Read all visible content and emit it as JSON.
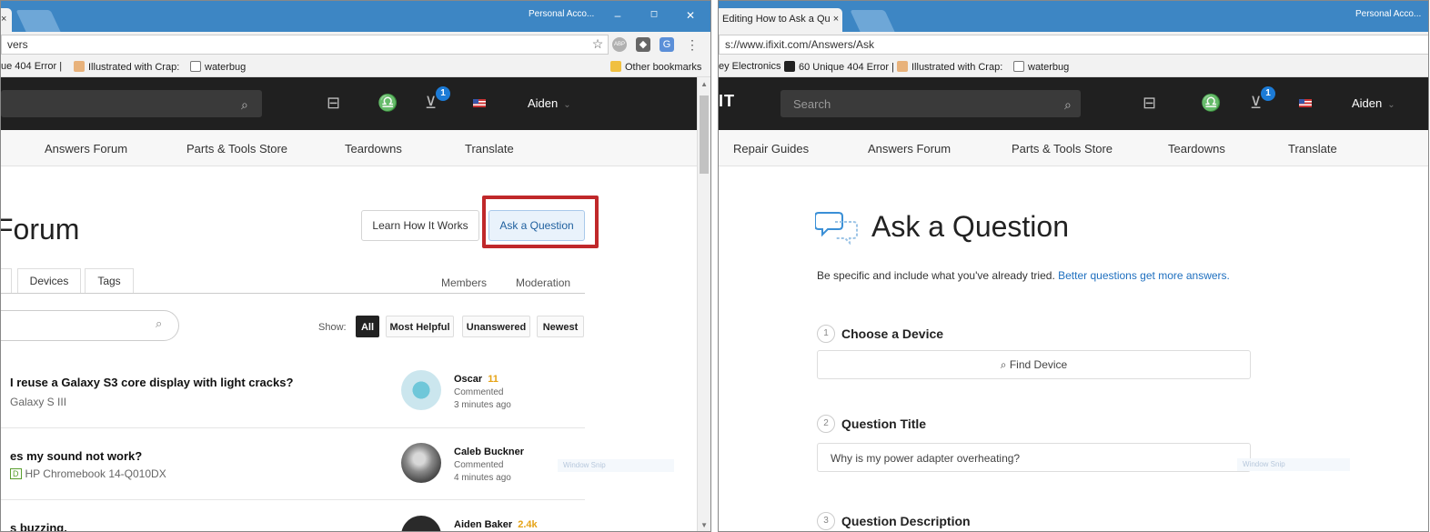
{
  "left": {
    "tab_close": "×",
    "profile": "Personal Acco...",
    "win_minimize": "–",
    "win_maximize": "◻",
    "win_close": "✕",
    "url": "vers",
    "bookmarks": [
      "ue 404 Error |",
      "Illustrated with Crap:",
      "waterbug"
    ],
    "other_bookmarks": "Other bookmarks",
    "cart_count": "1",
    "user": "Aiden",
    "nav": [
      "Answers Forum",
      "Parts & Tools Store",
      "Teardowns",
      "Translate"
    ],
    "title": "Forum",
    "learn_button": "Learn How It Works",
    "ask_button": "Ask a Question",
    "tabs": [
      "Devices",
      "Tags"
    ],
    "right_tabs": [
      "Members",
      "Moderation"
    ],
    "show_label": "Show:",
    "filters": [
      "All",
      "Most Helpful",
      "Unanswered",
      "Newest"
    ],
    "questions": [
      {
        "title": "I reuse a Galaxy S3 core display with light cracks?",
        "device_badge": "",
        "device": "Galaxy S III",
        "author": "Oscar",
        "rep": "11",
        "action": "Commented",
        "time": "3 minutes ago"
      },
      {
        "title": "es my sound not work?",
        "device_badge": "D",
        "device": "HP Chromebook 14-Q010DX",
        "author": "Caleb Buckner",
        "rep": "",
        "action": "Commented",
        "time": "4 minutes ago"
      },
      {
        "title": "s buzzing.",
        "device_badge": "",
        "device": "",
        "author": "Aiden Baker",
        "rep": "2.4k",
        "action": "",
        "time": ""
      }
    ],
    "snip_label": "Window Snip"
  },
  "right": {
    "tab_title": "Editing How to Ask a Qu",
    "tab_close": "×",
    "profile": "Personal Acco...",
    "url": "s://www.ifixit.com/Answers/Ask",
    "bookmarks": [
      "ey Electronics",
      "60 Unique 404 Error |",
      "Illustrated with Crap:",
      "waterbug"
    ],
    "logo": "IT",
    "search_placeholder": "Search",
    "cart_count": "1",
    "user": "Aiden",
    "nav": [
      "Repair Guides",
      "Answers Forum",
      "Parts & Tools Store",
      "Teardowns",
      "Translate"
    ],
    "title": "Ask a Question",
    "lead": "Be specific and include what you've already tried.",
    "lead_link": "Better questions get more answers.",
    "steps": [
      {
        "num": "1",
        "label": "Choose a Device"
      },
      {
        "num": "2",
        "label": "Question Title"
      },
      {
        "num": "3",
        "label": "Question Description"
      }
    ],
    "find_device": "Find Device",
    "title_value": "Why is my power adapter overheating?",
    "snip_label": "Window Snip"
  },
  "colors": {
    "chrome_blue": "#3d86c4",
    "site_header": "#202020",
    "highlight": "#c0282a",
    "link": "#1e6fbf",
    "rep_gold": "#e6a316"
  }
}
